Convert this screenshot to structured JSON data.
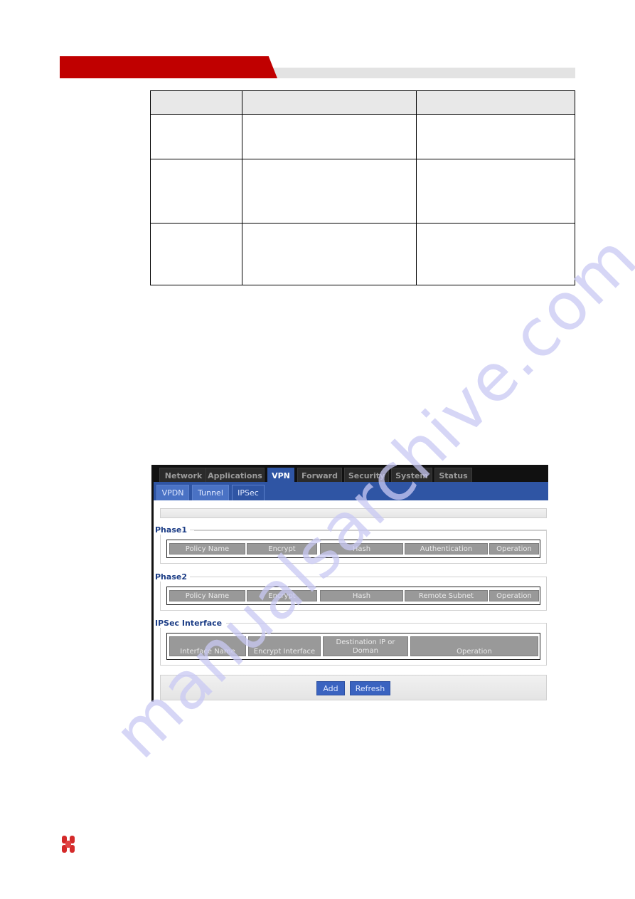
{
  "document": {
    "header_accent_color": "#c00000",
    "table": {
      "columns": 3,
      "header": [
        "",
        "",
        ""
      ],
      "rows": [
        [
          "",
          "",
          ""
        ],
        [
          "",
          "",
          ""
        ],
        [
          "",
          "",
          ""
        ]
      ]
    },
    "watermark": "manualsarchive.com"
  },
  "router_ui": {
    "main_tabs": [
      {
        "label": "Network",
        "active": false
      },
      {
        "label": "Applications",
        "active": false
      },
      {
        "label": "VPN",
        "active": true
      },
      {
        "label": "Forward",
        "active": false
      },
      {
        "label": "Security",
        "active": false
      },
      {
        "label": "System",
        "active": false
      },
      {
        "label": "Status",
        "active": false
      }
    ],
    "sub_tabs": [
      {
        "label": "VPDN",
        "active": false
      },
      {
        "label": "Tunnel",
        "active": false
      },
      {
        "label": "IPSec",
        "active": true
      }
    ],
    "sections": {
      "phase1": {
        "title": "Phase1",
        "columns": [
          "Policy Name",
          "Encrypt",
          "Hash",
          "Authentication",
          "Operation"
        ]
      },
      "phase2": {
        "title": "Phase2",
        "columns": [
          "Policy Name",
          "Encrypt",
          "Hash",
          "Remote Subnet",
          "Operation"
        ]
      },
      "ipsec_interface": {
        "title": "IPSec Interface",
        "columns": [
          "Interface Name",
          "Encrypt Interface",
          "Destination IP or Doman",
          "Operation"
        ]
      }
    },
    "buttons": {
      "add": "Add",
      "refresh": "Refresh"
    },
    "colors": {
      "nav_dark": "#111111",
      "accent_blue": "#2f55a4",
      "header_cell_grey": "#999999",
      "section_title": "#1c3d86"
    }
  }
}
